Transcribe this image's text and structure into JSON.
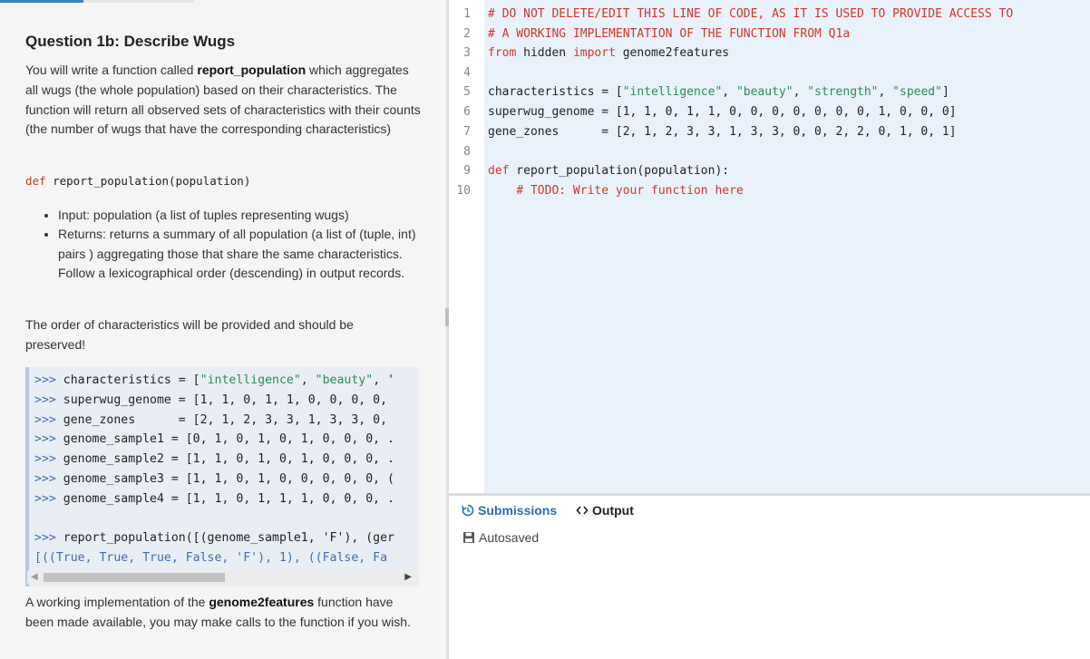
{
  "question": {
    "title": "Question 1b: Describe Wugs",
    "intro": {
      "p1": "You will write a function called ",
      "fn_name": "report_population",
      "p2": " which aggregates all wugs (the whole population) based on their characteristics. The function will return all observed sets of characteristics with their counts (the number of wugs that have the corresponding characteristics)"
    },
    "signature_kw": "def",
    "signature_rest": " report_population(population)",
    "bullets": [
      "Input: population (a list of tuples representing wugs)",
      "Returns: returns a summary of all population (a list of (tuple, int) pairs ) aggregating those that share the same characteristics. Follow a lexicographical order (descending) in output records."
    ],
    "order_note": "The order of characteristics will be provided and should be preserved!",
    "footer": {
      "p1": "A working implementation of the ",
      "fn_name": "genome2features",
      "p2": " function have been made available, you may make calls to the function if you wish."
    }
  },
  "doctest": {
    "prompt": ">>>",
    "lines": [
      {
        "code": " characteristics = [",
        "s1": "\"intelligence\"",
        "mid": ", ",
        "s2": "\"beauty\"",
        "tail": ", '"
      },
      {
        "code": " superwug_genome = [1, 1, 0, 1, 1, 0, 0, 0, 0,"
      },
      {
        "code": " gene_zones      = [2, 1, 2, 3, 3, 1, 3, 3, 0,"
      },
      {
        "code": " genome_sample1 = [0, 1, 0, 1, 0, 1, 0, 0, 0, ."
      },
      {
        "code": " genome_sample2 = [1, 1, 0, 1, 0, 1, 0, 0, 0, ."
      },
      {
        "code": " genome_sample3 = [1, 1, 0, 1, 0, 0, 0, 0, 0, ("
      },
      {
        "code": " genome_sample4 = [1, 1, 0, 1, 1, 1, 0, 0, 0, ."
      }
    ],
    "call_line": " report_population([(genome_sample1, 'F'), (ger",
    "output_line": "[((True, True, True, False, 'F'), 1), ((False, Fa"
  },
  "editor": {
    "line_numbers": [
      "1",
      "2",
      "3",
      "4",
      "5",
      "6",
      "7",
      "8",
      "9",
      "10"
    ],
    "line1": "# DO NOT DELETE/EDIT THIS LINE OF CODE, AS IT IS USED TO PROVIDE ACCESS TO",
    "line2": "# A WORKING IMPLEMENTATION OF THE FUNCTION FROM Q1a",
    "line3_from": "from",
    "line3_mid": " hidden ",
    "line3_import": "import",
    "line3_tail": " genome2features",
    "line5_pre": "characteristics = [",
    "line5_s1": "\"intelligence\"",
    "line5_s2": "\"beauty\"",
    "line5_s3": "\"strength\"",
    "line5_s4": "\"speed\"",
    "line5_sep": ", ",
    "line5_end": "]",
    "line6": "superwug_genome = [1, 1, 0, 1, 1, 0, 0, 0, 0, 0, 0, 0, 1, 0, 0, 0]",
    "line7": "gene_zones      = [2, 1, 2, 3, 3, 1, 3, 3, 0, 0, 2, 2, 0, 1, 0, 1]",
    "line9_kw": "def",
    "line9_rest": " report_population(population):",
    "line10_indent": "    ",
    "line10_comment": "# TODO: Write your function here"
  },
  "tabs": {
    "submissions": "Submissions",
    "output": "Output"
  },
  "status": {
    "autosaved": "Autosaved"
  },
  "icons": {
    "submissions": "history-icon",
    "output": "code-brackets-icon",
    "autosave": "floppy-disk-icon"
  },
  "colors": {
    "accent": "#2a6cc1",
    "keyword": "#d0362b",
    "string": "#2e8b57",
    "editor_bg": "#e9f2fb"
  }
}
